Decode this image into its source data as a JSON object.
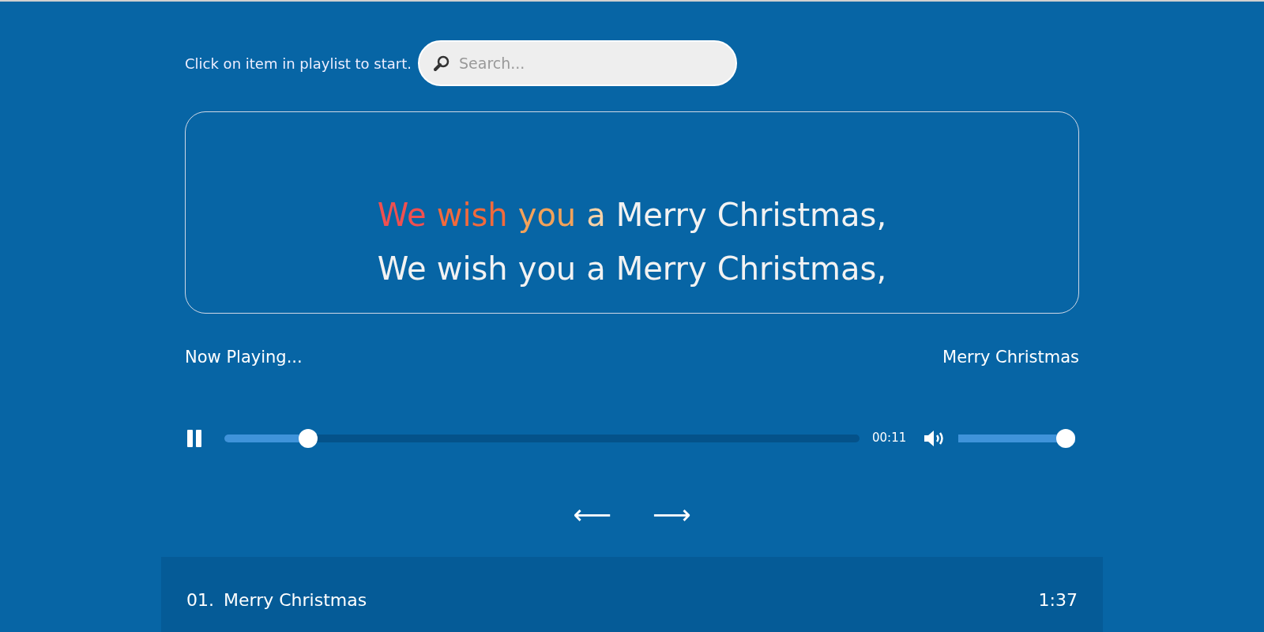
{
  "instruction": "Click on item in playlist to start.",
  "search": {
    "placeholder": "Search..."
  },
  "lyrics": [
    {
      "words": [
        {
          "text": "We",
          "color": "#f05050"
        },
        {
          "text": "wish",
          "color": "#f26a3c"
        },
        {
          "text": "you",
          "color": "#f2a25a"
        },
        {
          "text": "a",
          "color": "#f5d2a8"
        },
        {
          "text": "Merry",
          "color": "#f2f2f2"
        },
        {
          "text": "Christmas,",
          "color": "#f2f2f2"
        }
      ]
    },
    {
      "words": [
        {
          "text": "We",
          "color": "#f2f2f2"
        },
        {
          "text": "wish",
          "color": "#f2f2f2"
        },
        {
          "text": "you",
          "color": "#f2f2f2"
        },
        {
          "text": "a",
          "color": "#f2f2f2"
        },
        {
          "text": "Merry",
          "color": "#f2f2f2"
        },
        {
          "text": "Christmas,",
          "color": "#f2f2f2"
        }
      ]
    }
  ],
  "now_playing": {
    "label": "Now Playing...",
    "title": "Merry Christmas"
  },
  "player": {
    "playing": true,
    "progress": {
      "level": 0.12
    },
    "time": "00:11",
    "volume": {
      "level": 1.0
    }
  },
  "nav": {
    "previous": "⟵",
    "next": "⟶"
  },
  "playlist": [
    {
      "number": "01.",
      "title": "Merry Christmas",
      "duration": "1:37"
    }
  ]
}
